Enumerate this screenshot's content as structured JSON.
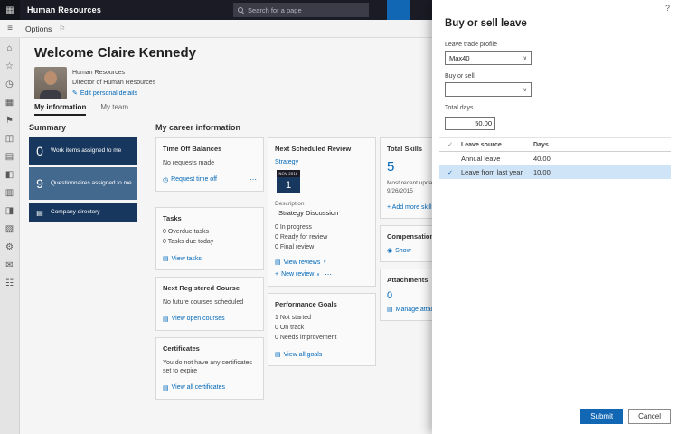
{
  "colors": {
    "accent": "#0067b8",
    "tile_dark": "#17375e",
    "tile_mid": "#44698f",
    "selected_row": "#cfe4f7",
    "topbar": "#1b1b26"
  },
  "glyphs": {
    "waffle": "▦",
    "burger": "≡",
    "flag": "⚐",
    "pencil": "✎",
    "view": "▤",
    "clock": "◷",
    "plus": "+",
    "chevron": "∨",
    "ellipsis": "⋯",
    "help": "?",
    "check": "✓",
    "show": "◉",
    "directory": "▤"
  },
  "topbar": {
    "title": "Human Resources",
    "search_placeholder": "Search for a page"
  },
  "optionsbar": {
    "label": "Options"
  },
  "sidebar": {
    "icons": [
      {
        "name": "home",
        "glyph": "⌂"
      },
      {
        "name": "favorites",
        "glyph": "☆"
      },
      {
        "name": "recent",
        "glyph": "◷"
      },
      {
        "name": "workspaces",
        "glyph": "▦"
      },
      {
        "name": "modules",
        "glyph": "⚑"
      },
      {
        "name": "company",
        "glyph": "◫"
      },
      {
        "name": "employees",
        "glyph": "▤"
      },
      {
        "name": "leave",
        "glyph": "◧"
      },
      {
        "name": "tasks",
        "glyph": "▥"
      },
      {
        "name": "compensation",
        "glyph": "◨"
      },
      {
        "name": "benefits",
        "glyph": "▧"
      },
      {
        "name": "settings",
        "glyph": "⚙"
      },
      {
        "name": "messages",
        "glyph": "✉"
      },
      {
        "name": "all-modules",
        "glyph": "☷"
      }
    ]
  },
  "main": {
    "welcome": "Welcome Claire Kennedy",
    "profile": {
      "department": "Human Resources",
      "role": "Director of Human Resources",
      "edit_link": "Edit personal details"
    },
    "tabs": [
      {
        "label": "My information"
      },
      {
        "label": "My team"
      }
    ],
    "summary": {
      "heading": "Summary",
      "tiles": [
        {
          "count": "0",
          "label": "Work items assigned to me"
        },
        {
          "count": "9",
          "label": "Questionnaires assigned to me"
        },
        {
          "label": "Company directory"
        }
      ]
    },
    "career": {
      "heading": "My career information",
      "time_off": {
        "title": "Time Off Balances",
        "body": "No requests made",
        "link": "Request time off"
      },
      "tasks": {
        "title": "Tasks",
        "line1": "0 Overdue tasks",
        "line2": "0 Tasks due today",
        "link": "View tasks"
      },
      "course": {
        "title": "Next Registered Course",
        "body": "No future courses scheduled",
        "link": "View open courses"
      },
      "certificates": {
        "title": "Certificates",
        "body": "You do not have any certificates set to expire",
        "link": "View all certificates"
      },
      "review": {
        "title": "Next Scheduled Review",
        "name": "Strategy",
        "cal_month": "NOV 2016",
        "cal_day": "1",
        "desc_label": "Description",
        "desc": "Strategy Discussion",
        "line1": "0 In progress",
        "line2": "0 Ready for review",
        "line3": "0 Final review",
        "link1": "View reviews",
        "link2": "New review"
      },
      "goals": {
        "title": "Performance Goals",
        "line1": "1 Not started",
        "line2": "0 On track",
        "line3": "0 Needs improvement",
        "link": "View all goals"
      },
      "skills": {
        "title": "Total Skills",
        "count": "5",
        "sub": "Most recent update",
        "date": "9/26/2015",
        "link": "+ Add more skills"
      },
      "compensation": {
        "title": "Compensation",
        "link": "Show"
      },
      "attachments": {
        "title": "Attachments",
        "count": "0",
        "link": "Manage attachments"
      }
    }
  },
  "panel": {
    "title": "Buy or sell leave",
    "fields": {
      "profile_label": "Leave trade profile",
      "profile_value": "Max40",
      "type_label": "Buy or sell",
      "type_value": "",
      "days_label": "Total days",
      "days_value": "50.00"
    },
    "table": {
      "col_source": "Leave source",
      "col_days": "Days",
      "rows": [
        {
          "source": "Annual leave",
          "days": "40.00"
        },
        {
          "source": "Leave from last year",
          "days": "10.00"
        }
      ]
    },
    "submit": "Submit",
    "cancel": "Cancel"
  }
}
